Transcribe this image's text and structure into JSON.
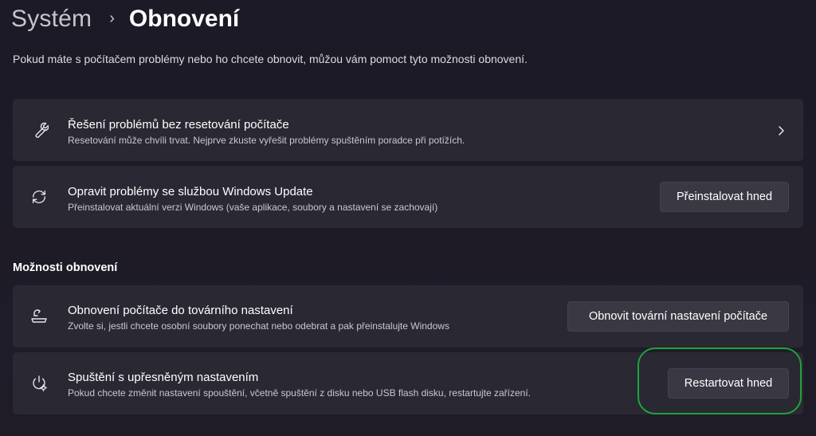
{
  "breadcrumb": {
    "parent": "Systém",
    "separator": "›",
    "current": "Obnovení"
  },
  "intro": "Pokud máte s počítačem problémy nebo ho chcete obnovit, můžou vám pomoct tyto možnosti obnovení.",
  "cards": [
    {
      "icon": "wrench-icon",
      "title": "Řešení problémů bez resetování počítače",
      "description": "Resetování může chvíli trvat. Nejprve zkuste vyřešit problémy spuštěním poradce při potížích.",
      "action": "chevron-right-icon"
    },
    {
      "icon": "refresh-icon",
      "title": "Opravit problémy se službou Windows Update",
      "description": "Přeinstalovat aktuální verzi Windows (vaše aplikace, soubory a nastavení se zachovají)",
      "button_label": "Přeinstalovat hned"
    }
  ],
  "section_title": "Možnosti obnovení",
  "recovery_options": [
    {
      "icon": "reset-pc-icon",
      "title": "Obnovení počítače do továrního nastavení",
      "description": "Zvolte si, jestli chcete osobní soubory ponechat nebo odebrat a pak přeinstalujte Windows",
      "button_label": "Obnovit tovární nastavení počítače"
    },
    {
      "icon": "advanced-startup-icon",
      "title": "Spuštění s upřesněným nastavením",
      "description": "Pokud chcete změnit nastavení spouštění, včetně spuštění z disku nebo USB flash disku, restartujte zařízení.",
      "button_label": "Restartovat hned"
    }
  ],
  "colors": {
    "background": "#1d1b27",
    "card": "#2a2833",
    "button": "#3a3843",
    "highlight": "#1fa43a"
  }
}
